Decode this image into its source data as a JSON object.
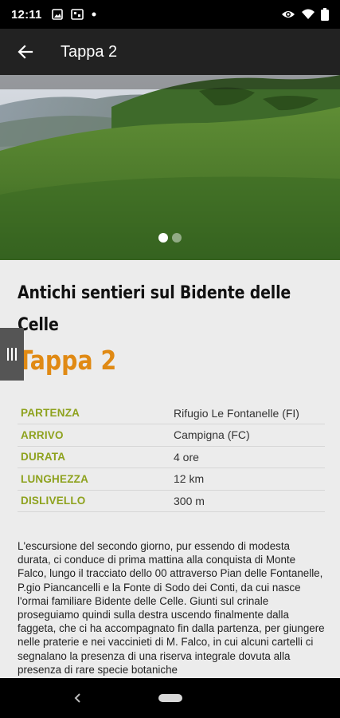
{
  "status_bar": {
    "time": "12:11",
    "left_icons": [
      "image-icon",
      "sim-icon",
      "dot-icon"
    ],
    "right_icons": [
      "eye-icon",
      "wifi-icon",
      "battery-icon"
    ]
  },
  "app_bar": {
    "title": "Tappa 2",
    "back_icon": "arrow-left-icon"
  },
  "carousel": {
    "slide_count": 2,
    "active_index": 0
  },
  "page": {
    "title": "Antichi sentieri sul Bidente delle Celle",
    "subtitle": "Tappa 2"
  },
  "info_table": [
    {
      "label": "PARTENZA",
      "value": "Rifugio Le Fontanelle (FI)"
    },
    {
      "label": "ARRIVO",
      "value": "Campigna (FC)"
    },
    {
      "label": "DURATA",
      "value": "4 ore"
    },
    {
      "label": "LUNGHEZZA",
      "value": "12 km"
    },
    {
      "label": "DISLIVELLO",
      "value": "300 m"
    }
  ],
  "description": "L'escursione del secondo giorno, pur essendo di modesta durata, ci conduce di prima mattina alla conquista di Monte Falco, lungo il tracciato dello 00 attraverso Pian delle Fontanelle, P.gio Piancancelli e la Fonte di Sodo dei Conti, da cui nasce l'ormai familiare Bidente delle Celle. Giunti sul crinale proseguiamo quindi sulla destra uscendo finalmente dalla faggeta, che ci ha accompagnato fin dalla partenza, per giungere nelle praterie e nei vaccinieti di M. Falco, in cui alcuni cartelli ci segnalano la presenza di una riserva integrale dovuta alla presenza di rare specie botaniche",
  "colors": {
    "accent_orange": "#e08a14",
    "label_green": "#8ea21e",
    "background": "#ececec"
  }
}
